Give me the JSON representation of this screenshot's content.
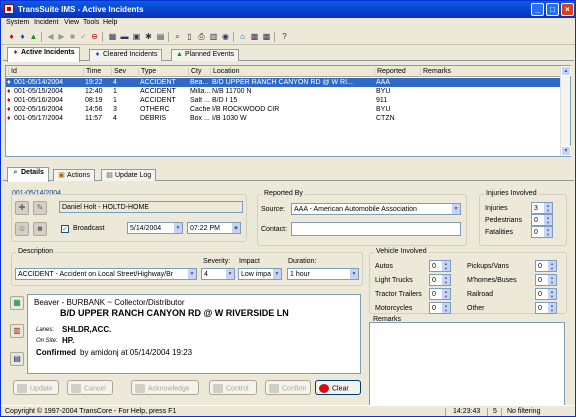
{
  "window": {
    "title": "TransSuite IMS - Active Incidents"
  },
  "menu": [
    "System",
    "Incident",
    "View",
    "Tools",
    "Help"
  ],
  "toolbar_icons": [
    "red-diamond-icon",
    "blue-diamond-icon",
    "green-triangle-icon",
    "back-arrow-icon",
    "forward-arrow-icon",
    "stop-icon",
    "checkmark-icon",
    "no-entry-icon",
    "map-icon",
    "car-icon",
    "camera-icon",
    "settings-icon",
    "reports-icon",
    "search-icon",
    "page-icon",
    "printer-icon",
    "chart-icon",
    "map-pin-icon",
    "sign-icon",
    "grid-icon",
    "help-icon"
  ],
  "tabs": [
    {
      "label": "Active Incidents",
      "icon": "red-diamond-icon",
      "active": true
    },
    {
      "label": "Cleared Incidents",
      "icon": "blue-diamond-icon",
      "active": false
    },
    {
      "label": "Planned Events",
      "icon": "green-triangle-icon",
      "active": false
    }
  ],
  "incident_table": {
    "columns": [
      "Id",
      "Time",
      "Sev",
      "Type",
      "Cty",
      "Location",
      "Reported",
      "Remarks"
    ],
    "rows": [
      {
        "id": "001-05/14/2004",
        "time": "19:22",
        "sev": "4",
        "type": "ACCIDENT",
        "cty": "Bea...",
        "location": "B/D UPPER RANCH CANYON RD @ W RI...",
        "reported": "AAA",
        "remarks": "",
        "selected": true
      },
      {
        "id": "001-05/15/2004",
        "time": "12:40",
        "sev": "1",
        "type": "ACCIDENT",
        "cty": "Milla...",
        "location": "N/B 11700 N",
        "reported": "BYU",
        "remarks": "",
        "selected": false
      },
      {
        "id": "001-05/16/2004",
        "time": "08:19",
        "sev": "1",
        "type": "ACCIDENT",
        "cty": "Salt ...",
        "location": "B/D I 15",
        "reported": "911",
        "remarks": "",
        "selected": false
      },
      {
        "id": "002-05/16/2004",
        "time": "14:56",
        "sev": "3",
        "type": "OTHERC",
        "cty": "Cache",
        "location": "I/B ROCKWOOD CIR",
        "reported": "BYU",
        "remarks": "",
        "selected": false
      },
      {
        "id": "001-05/17/2004",
        "time": "11:57",
        "sev": "4",
        "type": "DEBRIS",
        "cty": "Box ...",
        "location": "I/B 1030 W",
        "reported": "CTZN",
        "remarks": "",
        "selected": false
      }
    ]
  },
  "detail_tabs": [
    {
      "label": "Details",
      "icon": "search-icon",
      "active": true
    },
    {
      "label": "Actions",
      "icon": "actions-icon",
      "active": false
    },
    {
      "label": "Update Log",
      "icon": "log-icon",
      "active": false
    }
  ],
  "details": {
    "incident_id": "001-05/14/2004",
    "operator": "Daniel Holt - HOLTD-HOME",
    "broadcast_label": "Broadcast",
    "broadcast_checked": true,
    "date": "5/14/2004",
    "time": "07:22 PM",
    "reported_by": {
      "title": "Reported By",
      "source_label": "Source:",
      "source_value": "AAA - American Automobile Association",
      "contact_label": "Contact:",
      "contact_value": ""
    },
    "injuries": {
      "title": "Injuries Involved",
      "injuries_label": "Injuries",
      "injuries": "3",
      "pedestrians_label": "Pedestrians",
      "pedestrians": "0",
      "fatalities_label": "Fatalities",
      "fatalities": "0"
    },
    "description": {
      "title": "Description",
      "type_value": "ACCIDENT - Accident on Local Street/Highway/Br",
      "severity_label": "Severity:",
      "severity": "4",
      "impact_label": "Impact",
      "impact": "Low impa",
      "duration_label": "Duration:",
      "duration": "1 hour"
    },
    "vehicles": {
      "title": "Vehicle Involved",
      "autos_label": "Autos",
      "autos": "0",
      "light_trucks_label": "Light Trucks",
      "light_trucks": "0",
      "tractor_trailers_label": "Tractor Trailers",
      "tractor_trailers": "0",
      "motorcycles_label": "Motorcycles",
      "motorcycles": "0",
      "pickups_label": "Pickups/Vans",
      "pickups": "0",
      "mhomes_label": "M'homes/Buses",
      "mhomes": "0",
      "railroad_label": "Railroad",
      "railroad": "0",
      "other_label": "Other",
      "other": "0"
    },
    "notes": {
      "line1": "Beaver - BURBANK ~ Collector/Distributor",
      "line2": "B/D UPPER RANCH CANYON RD @ W RIVERSIDE LN",
      "lanes_label": "Lanes:",
      "lanes": "SHLDR,ACC.",
      "onsite_label": "On Site:",
      "onsite": "HP.",
      "confirmed_label": "Confirmed",
      "confirmed_by": "by amidonj at 05/14/2004 19:23"
    },
    "remarks_title": "Remarks",
    "remarks_value": ""
  },
  "buttons": {
    "update": "Update",
    "cancel": "Cancel",
    "acknowledge": "Acknowledge",
    "control": "Control",
    "confirm": "Confirm",
    "clear": "Clear"
  },
  "statusbar": {
    "copyright": "Copyright © 1997-2004 TransCore - For Help, press F1",
    "time": "14:23:43",
    "count": "5",
    "filter": "No filtering"
  }
}
